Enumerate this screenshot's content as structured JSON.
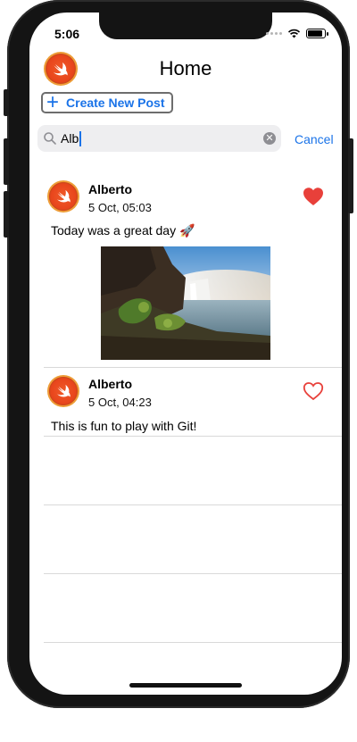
{
  "status": {
    "time": "5:06"
  },
  "header": {
    "title": "Home",
    "create_label": "Create New Post"
  },
  "search": {
    "value": "Alb",
    "cancel_label": "Cancel"
  },
  "posts": [
    {
      "author": "Alberto",
      "date": "5 Oct, 05:03",
      "text": "Today was a great day 🚀",
      "liked": true,
      "has_image": true
    },
    {
      "author": "Alberto",
      "date": "5 Oct, 04:23",
      "text": "This is fun to play with Git!",
      "liked": false,
      "has_image": false
    }
  ],
  "colors": {
    "accent": "#1a73e8",
    "heart": "#e8403a"
  }
}
